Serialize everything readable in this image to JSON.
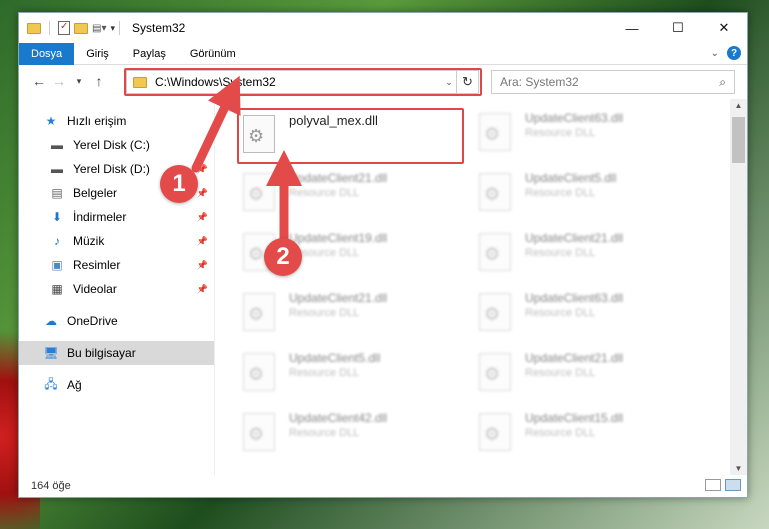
{
  "window": {
    "title": "System32"
  },
  "ribbon": {
    "tabs": [
      "Dosya",
      "Giriş",
      "Paylaş",
      "Görünüm"
    ]
  },
  "address": {
    "path": "C:\\Windows\\System32"
  },
  "search": {
    "placeholder": "Ara: System32"
  },
  "sidebar": {
    "items": [
      {
        "label": "Hızlı erişim",
        "icon": "star-icon"
      },
      {
        "label": "Yerel Disk (C:)",
        "icon": "drive-icon"
      },
      {
        "label": "Yerel Disk (D:)",
        "icon": "drive-icon"
      },
      {
        "label": "Belgeler",
        "icon": "documents-icon"
      },
      {
        "label": "İndirmeler",
        "icon": "download-icon"
      },
      {
        "label": "Müzik",
        "icon": "music-icon"
      },
      {
        "label": "Resimler",
        "icon": "pictures-icon"
      },
      {
        "label": "Videolar",
        "icon": "videos-icon"
      },
      {
        "label": "OneDrive",
        "icon": "cloud-icon"
      },
      {
        "label": "Bu bilgisayar",
        "icon": "computer-icon"
      },
      {
        "label": "Ağ",
        "icon": "network-icon"
      }
    ]
  },
  "files": {
    "highlighted": {
      "name": "polyval_mex.dll"
    },
    "col1": [
      {
        "name": "UpdateClient21.dll",
        "type": "Resource DLL"
      },
      {
        "name": "UpdateClient19.dll",
        "type": "Resource DLL"
      },
      {
        "name": "UpdateClient21.dll",
        "type": "Resource DLL"
      },
      {
        "name": "UpdateClient5.dll",
        "type": "Resource DLL"
      },
      {
        "name": "UpdateClient42.dll",
        "type": "Resource DLL"
      }
    ],
    "col2": [
      {
        "name": "UpdateClient63.dll",
        "type": "Resource DLL"
      },
      {
        "name": "UpdateClient5.dll",
        "type": "Resource DLL"
      },
      {
        "name": "UpdateClient21.dll",
        "type": "Resource DLL"
      },
      {
        "name": "UpdateClient63.dll",
        "type": "Resource DLL"
      },
      {
        "name": "UpdateClient21.dll",
        "type": "Resource DLL"
      },
      {
        "name": "UpdateClient15.dll",
        "type": "Resource DLL"
      }
    ]
  },
  "status": {
    "count": "164 öğe"
  },
  "annotations": {
    "step1": "1",
    "step2": "2"
  },
  "colors": {
    "accent": "#1979ca",
    "annotation": "#e34b4b"
  }
}
